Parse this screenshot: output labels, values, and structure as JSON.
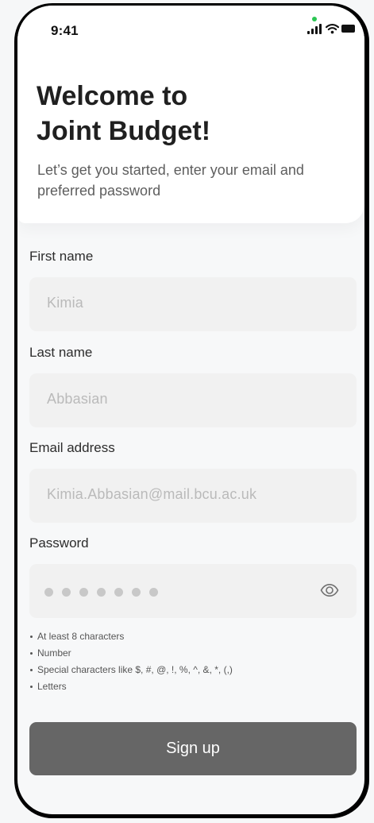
{
  "status_bar": {
    "time": "9:41",
    "icons": [
      "signal-icon",
      "wifi-icon",
      "battery-icon"
    ],
    "privacy_indicator_color": "#2bc653"
  },
  "header": {
    "title_line_1": "Welcome to",
    "title_line_2": "Joint Budget!",
    "subtitle": "Let’s get you started, enter your email and preferred password"
  },
  "form": {
    "first_name": {
      "label": "First name",
      "placeholder": "Kimia"
    },
    "last_name": {
      "label": "Last name",
      "placeholder": "Abbasian"
    },
    "email": {
      "label": "Email address",
      "placeholder": "Kimia.Abbasian@mail.bcu.ac.uk"
    },
    "password": {
      "label": "Password",
      "masked_length": 7,
      "visibility_icon": "eye-icon",
      "rules": [
        "At least 8 characters",
        "Number",
        "Special characters like $, #, @, !, %, ^, &, *, (,)",
        "Letters"
      ]
    },
    "signup_label": "Sign up"
  },
  "colors": {
    "button": "#666666",
    "input_background": "#f1f1f1",
    "text": "#202020",
    "placeholder": "#bababa"
  }
}
